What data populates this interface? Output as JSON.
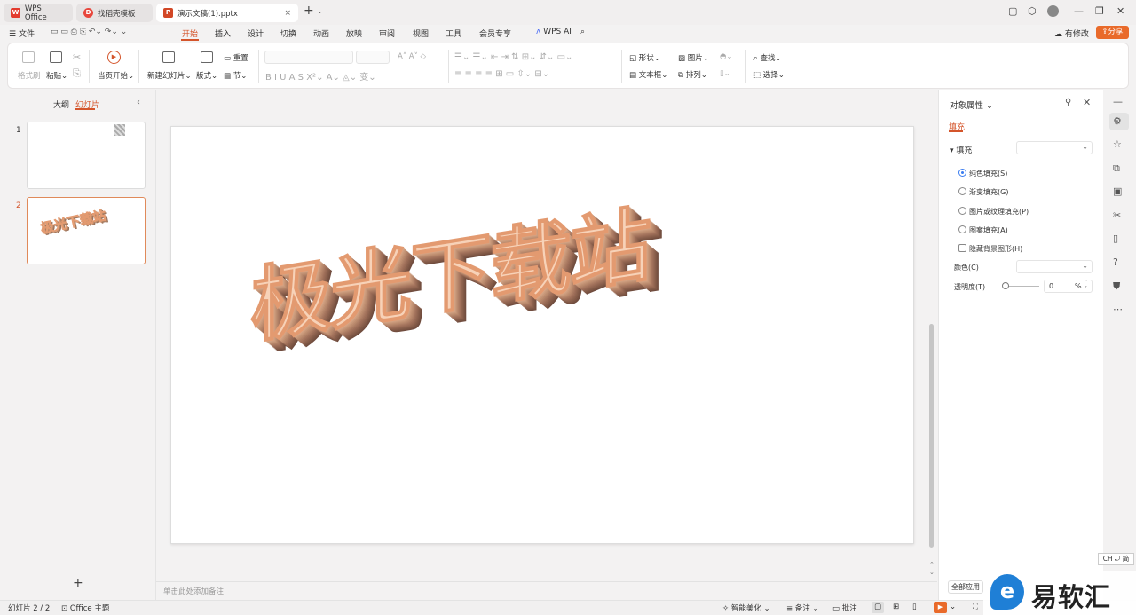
{
  "tabs": [
    {
      "label": "WPS Office"
    },
    {
      "label": "找稻壳模板"
    },
    {
      "label": "演示文稿(1).pptx"
    }
  ],
  "menu": {
    "file": "文件",
    "items": [
      "开始",
      "插入",
      "设计",
      "切换",
      "动画",
      "放映",
      "审阅",
      "视图",
      "工具",
      "会员专享"
    ],
    "wps_ai": "WPS AI",
    "has_changes": "有修改",
    "share": "分享"
  },
  "ribbon": {
    "format_painter": "格式刷",
    "paste": "粘贴",
    "from_current": "当页开始",
    "new_slide": "新建幻灯片",
    "layout": "版式",
    "section": "节",
    "reset": "重置",
    "shape": "形状",
    "picture": "图片",
    "textbox": "文本框",
    "arrange": "排列",
    "find": "查找",
    "select": "选择"
  },
  "left": {
    "outline": "大纲",
    "slides": "幻灯片",
    "slide_nums": [
      "1",
      "2"
    ],
    "add": "+"
  },
  "slide": {
    "wordart": "极光下载站"
  },
  "notes_placeholder": "单击此处添加备注",
  "right": {
    "title": "对象属性",
    "tab_fill": "填充",
    "section_fill": "填充",
    "options": [
      "纯色填充(S)",
      "渐变填充(G)",
      "图片或纹理填充(P)",
      "图案填充(A)"
    ],
    "hide_bg": "隐藏背景图形(H)",
    "color_label": "颜色(C)",
    "transparency_label": "透明度(T)",
    "transparency_value": "0",
    "pct": "%",
    "apply_all": "全部应用"
  },
  "status": {
    "slide_count": "幻灯片 2 / 2",
    "theme": "Office 主题",
    "beautify": "智能美化",
    "notes": "备注",
    "comments": "批注"
  },
  "ime": "CH ⤾ 简",
  "watermark": "易软汇"
}
